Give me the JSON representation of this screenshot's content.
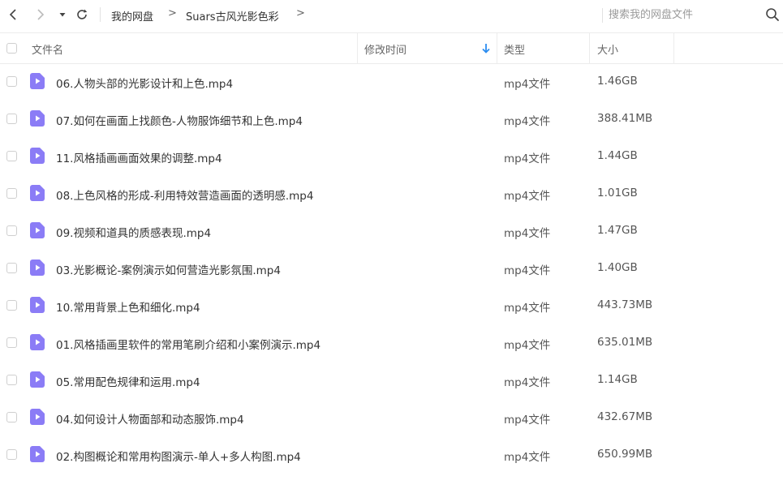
{
  "nav": {
    "back_icon": "chevron-left-icon",
    "forward_icon": "chevron-right-icon",
    "dropdown_icon": "caret-down-icon",
    "refresh_icon": "refresh-icon"
  },
  "breadcrumb": {
    "root": "我的网盘",
    "current": "Suars古风光影色彩",
    "separator": ">"
  },
  "search": {
    "placeholder": "搜索我的网盘文件",
    "icon": "search-icon"
  },
  "table": {
    "headers": {
      "name": "文件名",
      "modified": "修改时间",
      "type": "类型",
      "size": "大小"
    },
    "sort_icon": "arrow-down-icon",
    "accent_color": "#2b8cf0",
    "file_icon_color": "#8b7cf6",
    "rows": [
      {
        "name": "06.人物头部的光影设计和上色.mp4",
        "type": "mp4文件",
        "size": "1.46GB"
      },
      {
        "name": "07.如何在画面上找颜色-人物服饰细节和上色.mp4",
        "type": "mp4文件",
        "size": "388.41MB"
      },
      {
        "name": "11.风格插画画面效果的调整.mp4",
        "type": "mp4文件",
        "size": "1.44GB"
      },
      {
        "name": "08.上色风格的形成-利用特效营造画面的透明感.mp4",
        "type": "mp4文件",
        "size": "1.01GB"
      },
      {
        "name": "09.视频和道具的质感表现.mp4",
        "type": "mp4文件",
        "size": "1.47GB"
      },
      {
        "name": "03.光影概论-案例演示如何营造光影氛围.mp4",
        "type": "mp4文件",
        "size": "1.40GB"
      },
      {
        "name": "10.常用背景上色和细化.mp4",
        "type": "mp4文件",
        "size": "443.73MB"
      },
      {
        "name": "01.风格插画里软件的常用笔刷介绍和小案例演示.mp4",
        "type": "mp4文件",
        "size": "635.01MB"
      },
      {
        "name": "05.常用配色规律和运用.mp4",
        "type": "mp4文件",
        "size": "1.14GB"
      },
      {
        "name": "04.如何设计人物面部和动态服饰.mp4",
        "type": "mp4文件",
        "size": "432.67MB"
      },
      {
        "name": "02.构图概论和常用构图演示-单人+多人构图.mp4",
        "type": "mp4文件",
        "size": "650.99MB"
      }
    ]
  }
}
